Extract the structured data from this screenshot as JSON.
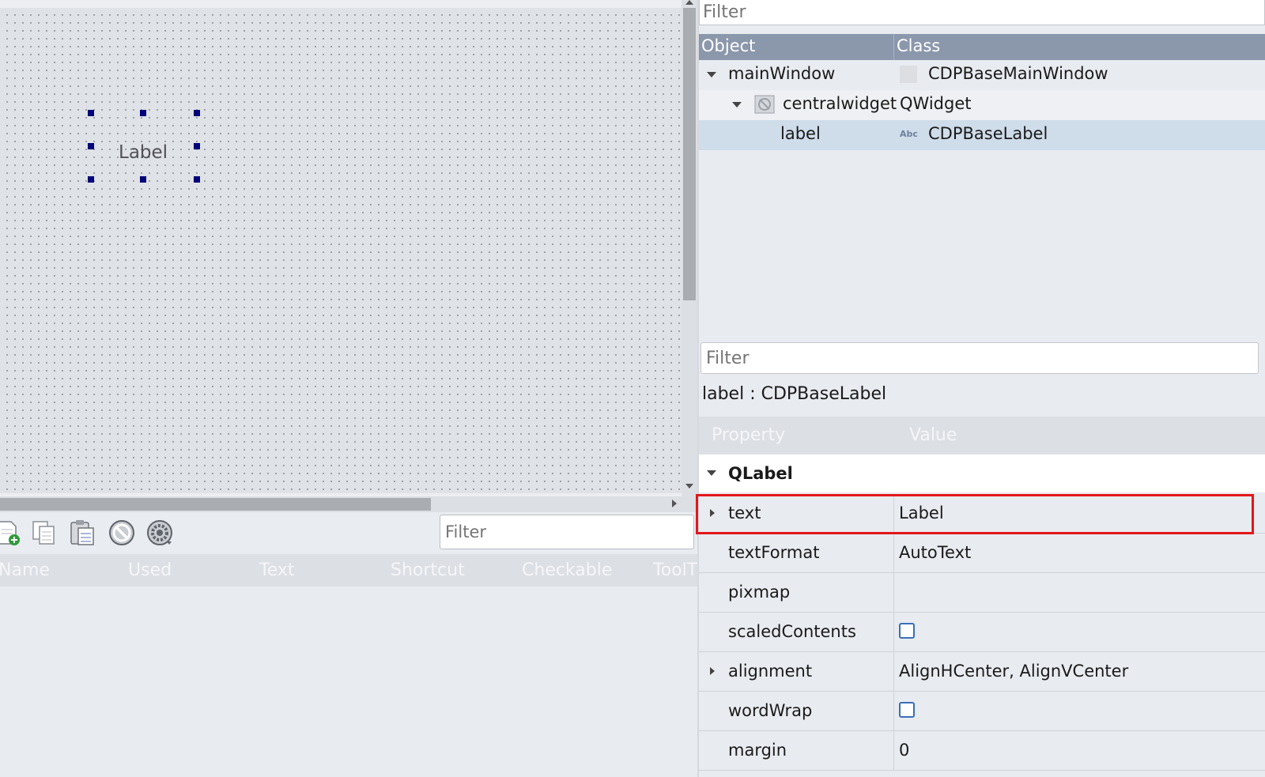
{
  "canvas": {
    "label_text": "Label"
  },
  "action_editor": {
    "filter_placeholder": "Filter",
    "columns": [
      "Name",
      "Used",
      "Text",
      "Shortcut",
      "Checkable",
      "ToolT"
    ],
    "toolbar_icons": [
      "new-action-icon",
      "copy-icon",
      "paste-icon",
      "delete-icon",
      "settings-icon"
    ]
  },
  "object_inspector": {
    "filter_placeholder": "Filter",
    "columns": [
      "Object",
      "Class"
    ],
    "rows": [
      {
        "object": "mainWindow",
        "class": "CDPBaseMainWindow"
      },
      {
        "object": "centralwidget",
        "class": "QWidget"
      },
      {
        "object": "label",
        "class": "CDPBaseLabel",
        "class_icon_text": "Abc"
      }
    ]
  },
  "property_editor": {
    "filter_placeholder": "Filter",
    "caption": "label : CDPBaseLabel",
    "columns": [
      "Property",
      "Value"
    ],
    "group": "QLabel",
    "properties": [
      {
        "name": "text",
        "value": "Label"
      },
      {
        "name": "textFormat",
        "value": "AutoText"
      },
      {
        "name": "pixmap",
        "value": ""
      },
      {
        "name": "scaledContents",
        "value": ""
      },
      {
        "name": "alignment",
        "value": "AlignHCenter, AlignVCenter"
      },
      {
        "name": "wordWrap",
        "value": ""
      },
      {
        "name": "margin",
        "value": "0"
      }
    ]
  }
}
